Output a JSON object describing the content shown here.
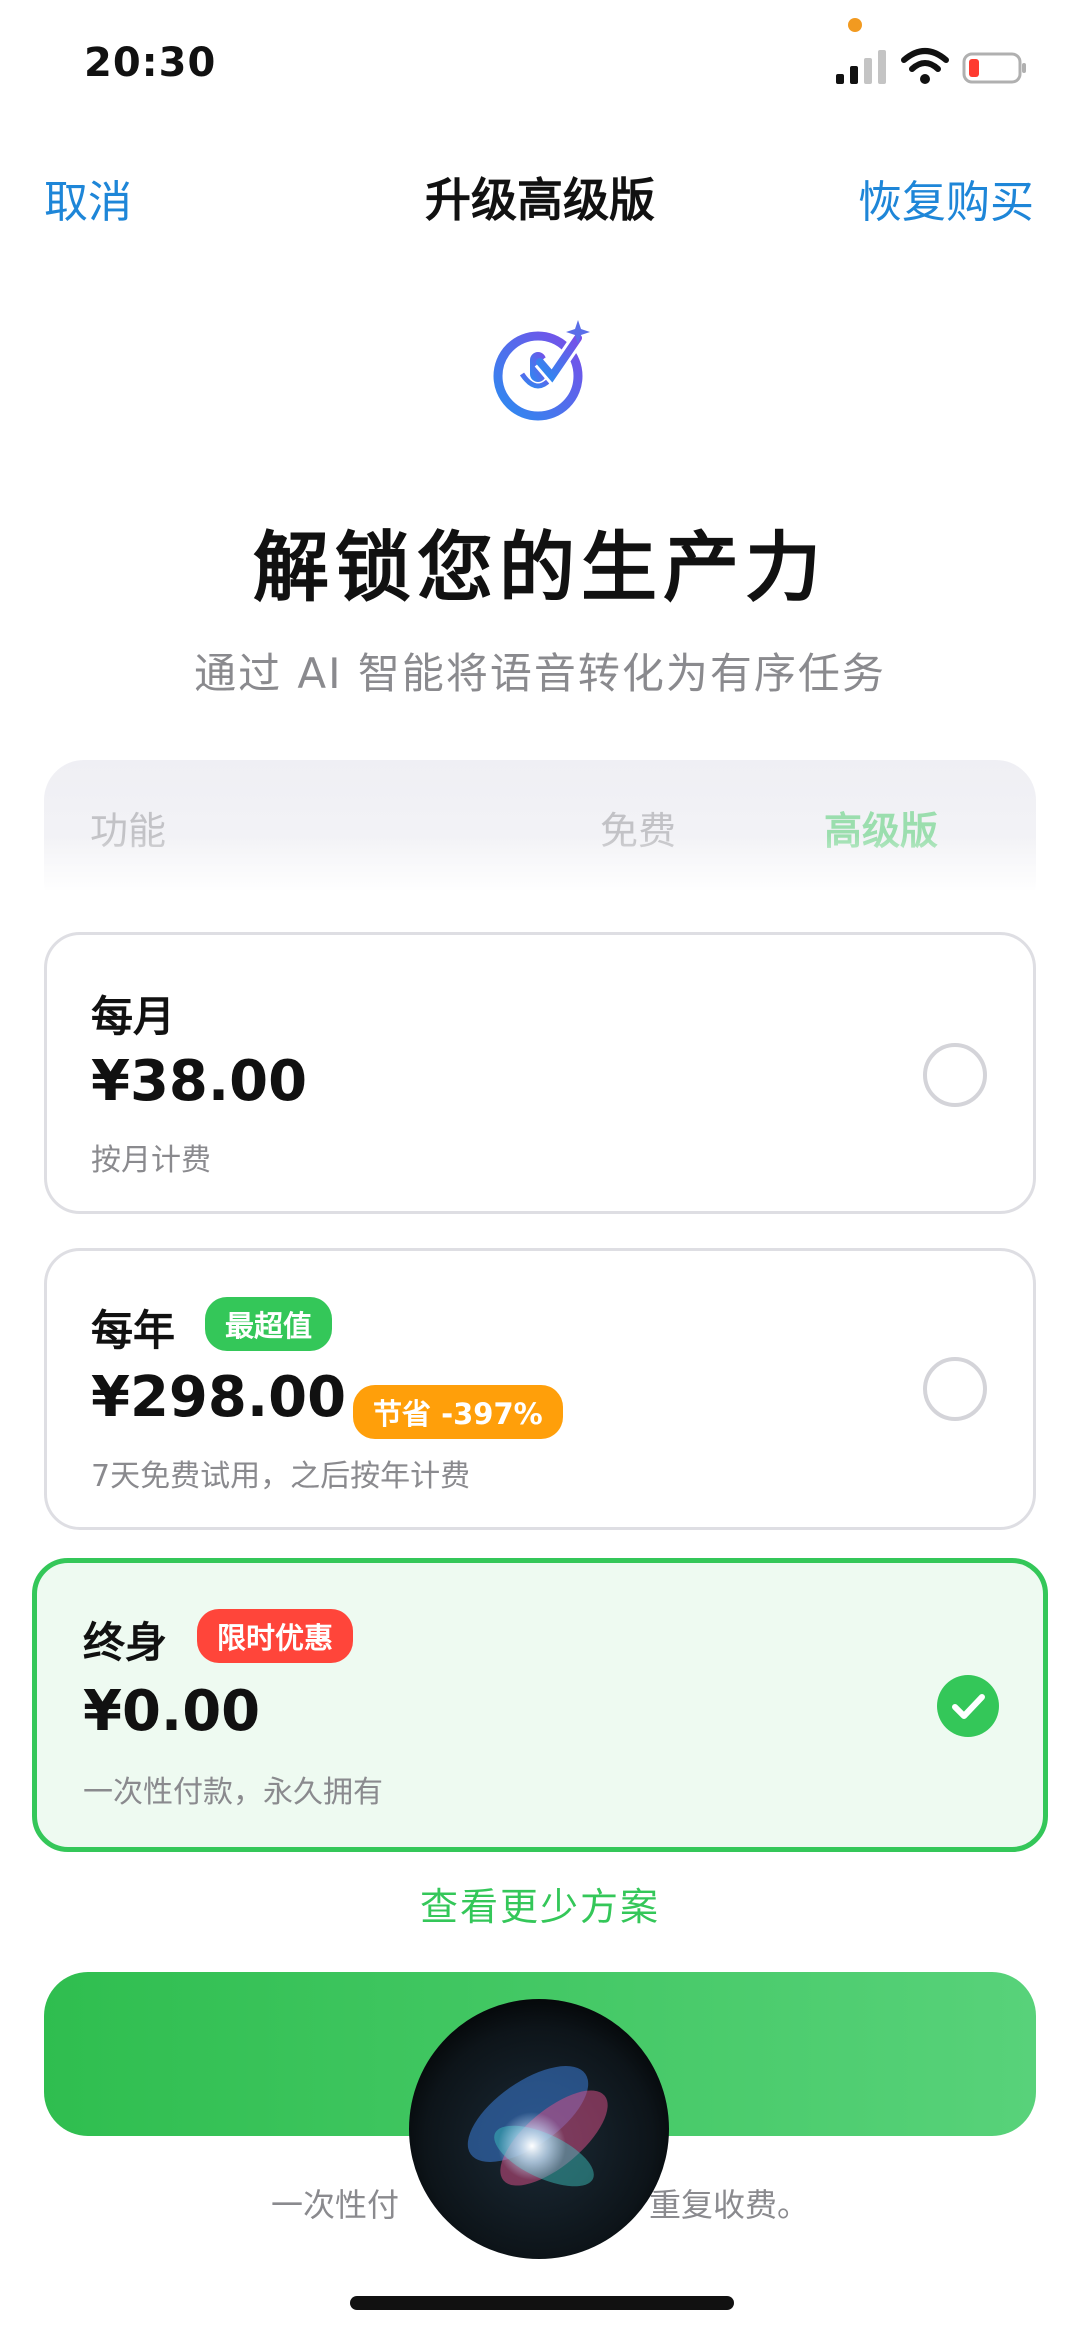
{
  "status_bar": {
    "time": "20:30",
    "icons": [
      "signal-icon",
      "wifi-icon",
      "battery-icon"
    ]
  },
  "nav": {
    "cancel": "取消",
    "title": "升级高级版",
    "restore": "恢复购买"
  },
  "hero": {
    "icon": "ai-voice-mic-icon",
    "title": "解锁您的生产力",
    "subtitle": "通过 AI 智能将语音转化为有序任务"
  },
  "comparison": {
    "col_feature": "功能",
    "col_free": "免费",
    "col_premium": "高级版"
  },
  "plans": [
    {
      "name": "每月",
      "price": "¥38.00",
      "note": "按月计费",
      "selected": false
    },
    {
      "name": "每年",
      "badge": "最超值",
      "price": "¥298.00",
      "save_badge": "节省 -397%",
      "note": "7天免费试用，之后按年计费",
      "selected": false
    },
    {
      "name": "终身",
      "badge": "限时优惠",
      "price": "¥0.00",
      "note": "一次性付款，永久拥有",
      "selected": true
    }
  ],
  "show_fewer": "查看更少方案",
  "footer_note": "一次性付",
  "footer_note_tail": "重复收费。",
  "colors": {
    "accent_green": "#34c759",
    "link_blue": "#1e86d8",
    "save_orange": "#ff9f0a",
    "deal_red": "#ff453a"
  }
}
